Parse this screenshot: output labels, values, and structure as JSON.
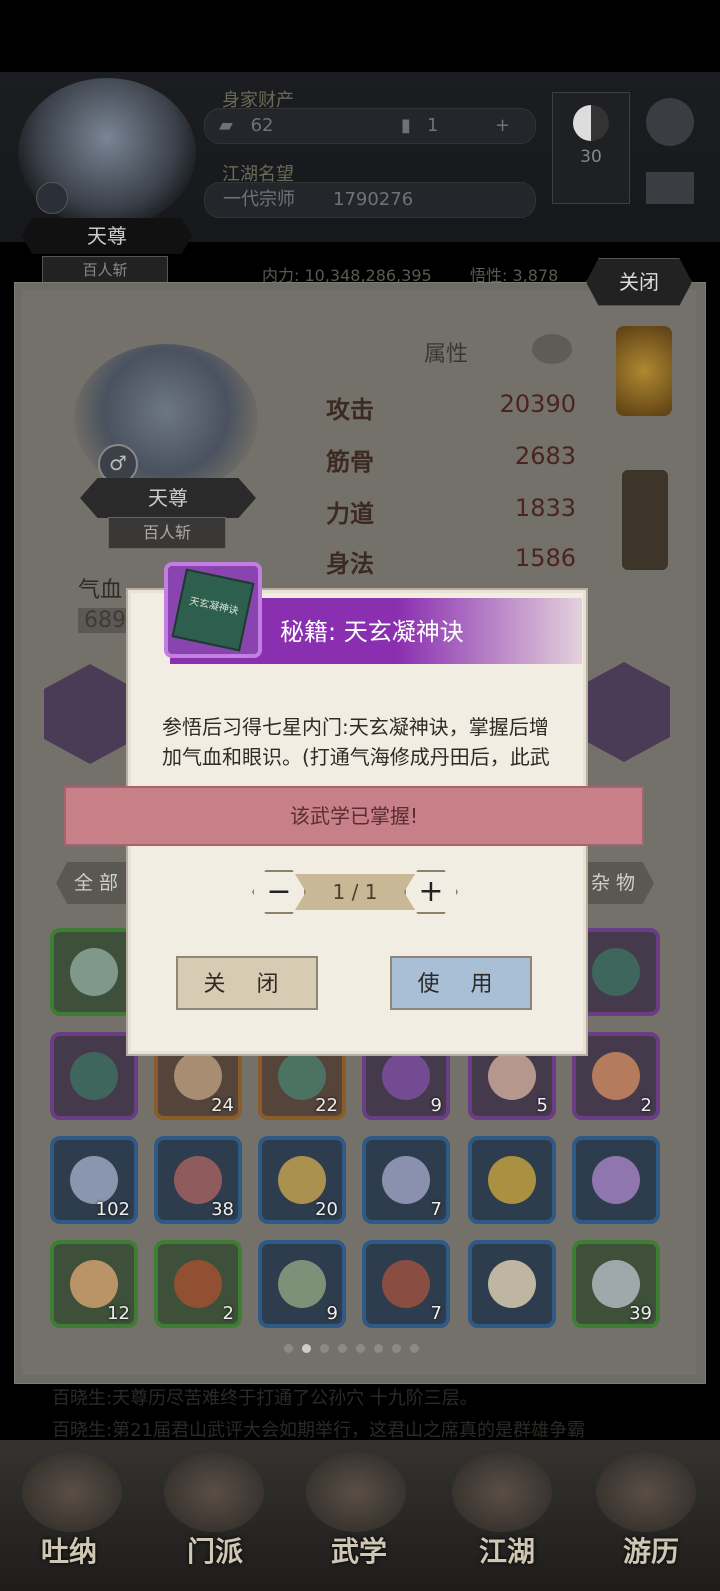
{
  "hud": {
    "resources_label": "身家财产",
    "gold": "62",
    "tickets": "1",
    "fame_label": "江湖名望",
    "rank": "一代宗师",
    "fame_value": "1790276",
    "yinyang_level": "30",
    "player_name": "天尊",
    "player_title": "百人斩",
    "neili": "内力: 10,348,286,395",
    "wuxing": "悟性: 3,878"
  },
  "panel": {
    "close_label": "关闭",
    "character_name": "天尊",
    "character_title": "百人斩",
    "gender_icon": "♂",
    "attributes_header": "属性",
    "attributes": [
      {
        "name": "攻击",
        "value": "20390"
      },
      {
        "name": "筋骨",
        "value": "2683"
      },
      {
        "name": "力道",
        "value": "1833"
      },
      {
        "name": "身法",
        "value": "1586"
      }
    ],
    "qixue_label": "气血",
    "qixue_value": "689",
    "filter_all": "全 部",
    "filter_misc": "杂 物"
  },
  "inventory": [
    {
      "rarity": "g",
      "count": ""
    },
    {
      "rarity": "p",
      "count": ""
    },
    {
      "rarity": "p",
      "count": ""
    },
    {
      "rarity": "o",
      "count": "24"
    },
    {
      "rarity": "o",
      "count": "22"
    },
    {
      "rarity": "p",
      "count": "9"
    },
    {
      "rarity": "p",
      "count": "5"
    },
    {
      "rarity": "p",
      "count": "2"
    },
    {
      "rarity": "b",
      "count": "102"
    },
    {
      "rarity": "b",
      "count": "38"
    },
    {
      "rarity": "b",
      "count": "20"
    },
    {
      "rarity": "b",
      "count": "7"
    },
    {
      "rarity": "b",
      "count": ""
    },
    {
      "rarity": "b",
      "count": ""
    },
    {
      "rarity": "g",
      "count": "12"
    },
    {
      "rarity": "g",
      "count": "2"
    },
    {
      "rarity": "b",
      "count": "9"
    },
    {
      "rarity": "b",
      "count": "7"
    },
    {
      "rarity": "b",
      "count": ""
    },
    {
      "rarity": "g",
      "count": "39"
    }
  ],
  "news": [
    "百晓生:天尊历尽苦难终于打通了公孙穴 十九阶三层。",
    "百晓生:第21届君山武评大会如期举行，这君山之席真的是群雄争霸"
  ],
  "bottom_nav": [
    "吐纳",
    "门派",
    "武学",
    "江湖",
    "游历"
  ],
  "dialog": {
    "title": "秘籍: 天玄凝神诀",
    "book_cover_text": "天玄凝神诀",
    "description": "参悟后习得七星内门:天玄凝神诀，掌握后增加气血和眼识。(打通气海修成丹田后，此武学还可以修炼至返璞归真境界)",
    "toast": "该武学已掌握!",
    "quantity": "1 / 1",
    "minus_label": "−",
    "plus_label": "+",
    "close_button": "关 闭",
    "use_button": "使 用"
  }
}
